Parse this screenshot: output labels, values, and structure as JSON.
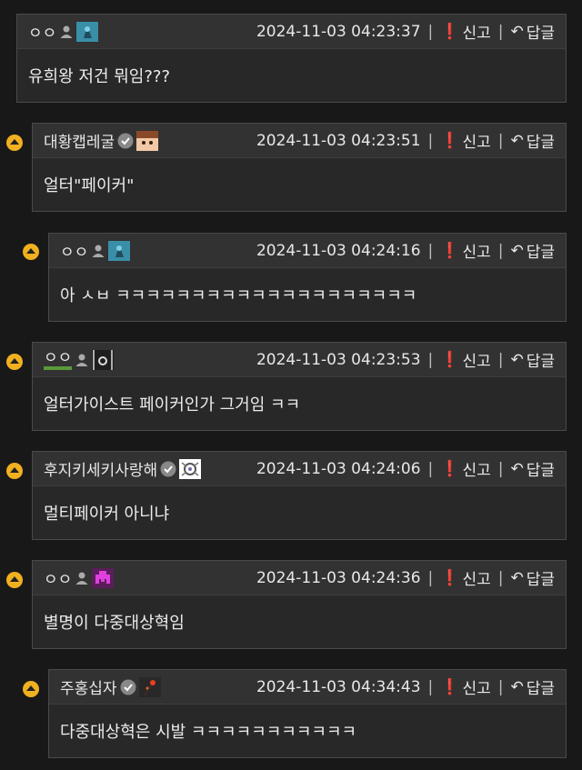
{
  "common": {
    "report_label": "신고",
    "reply_label": "답글"
  },
  "comments": [
    {
      "nick": "ㅇㅇ",
      "date": "2024-11-03 04:23:37",
      "text": "유희왕 저건 뭐임???"
    },
    {
      "nick": "대황캡레굴",
      "date": "2024-11-03 04:23:51",
      "text": "얼터\"페이커\""
    },
    {
      "nick": "ㅇㅇ",
      "date": "2024-11-03 04:24:16",
      "text": "아 ㅅㅂ ㅋㅋㅋㅋㅋㅋㅋㅋㅋㅋㅋㅋㅋㅋㅋㅋㅋㅋㅋㅋ"
    },
    {
      "nick": "ㅇㅇ",
      "date": "2024-11-03 04:23:53",
      "text": "얼터가이스트 페이커인가 그거임 ㅋㅋ"
    },
    {
      "nick": "후지키세키사랑해",
      "date": "2024-11-03 04:24:06",
      "text": "멀티페이커 아니냐"
    },
    {
      "nick": "ㅇㅇ",
      "date": "2024-11-03 04:24:36",
      "text": "별명이 다중대상혁임"
    },
    {
      "nick": "주홍십자",
      "date": "2024-11-03 04:34:43",
      "text": "다중대상혁은 시발 ㅋㅋㅋㅋㅋㅋㅋㅋㅋㅋㅋ"
    }
  ],
  "colors": {
    "thread_marker": "#f0b020",
    "background": "#181818",
    "card": "#282828",
    "header": "#323232"
  }
}
